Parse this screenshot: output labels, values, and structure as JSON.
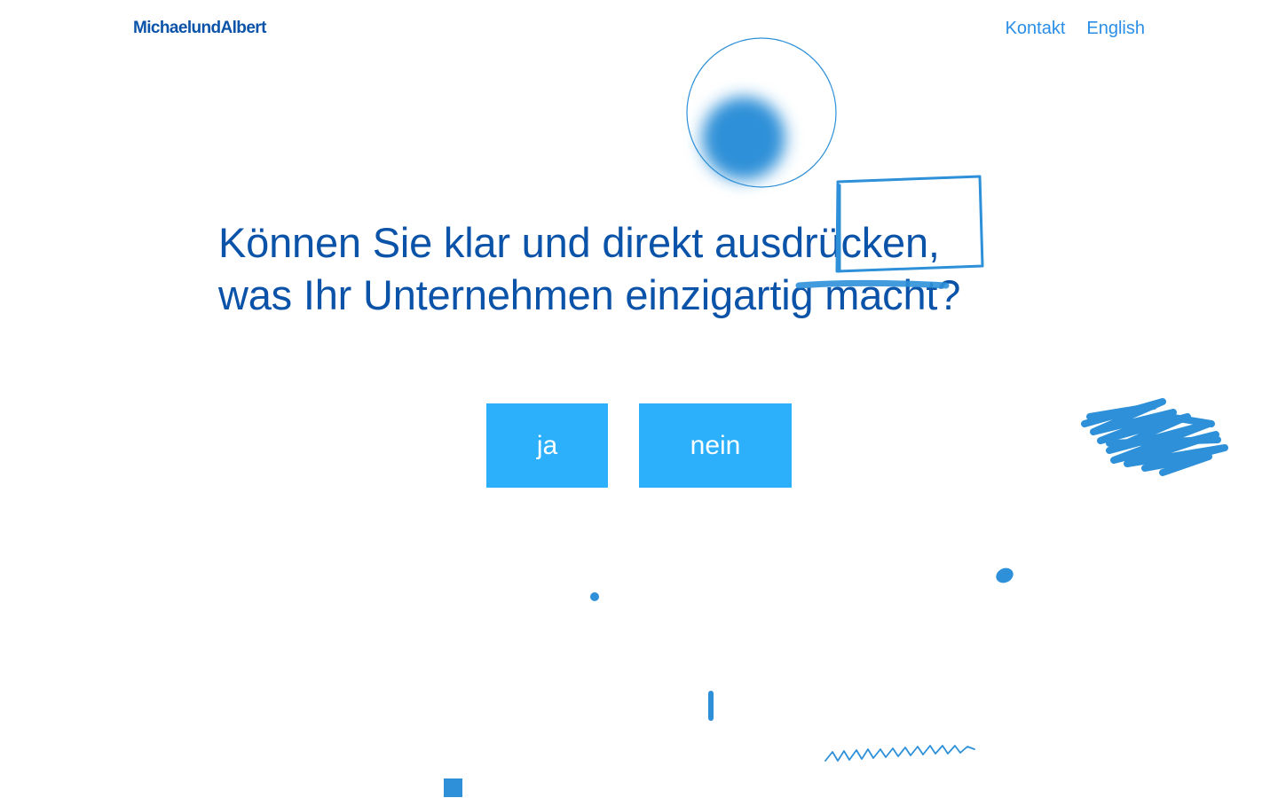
{
  "header": {
    "logo": "MichaelundAlbert",
    "nav": [
      {
        "label": "Kontakt"
      },
      {
        "label": "English"
      }
    ]
  },
  "hero": {
    "question_line1": "Können Sie klar und direkt ausdrücken,",
    "question_line2": "was Ihr Unternehmen einzigartig macht?"
  },
  "answers": {
    "yes_label": "ja",
    "no_label": "nein"
  },
  "colors": {
    "brand": "#0b53a8",
    "link": "#2a8ee6",
    "button": "#2cb0fb",
    "sketch": "#2e90d8"
  }
}
